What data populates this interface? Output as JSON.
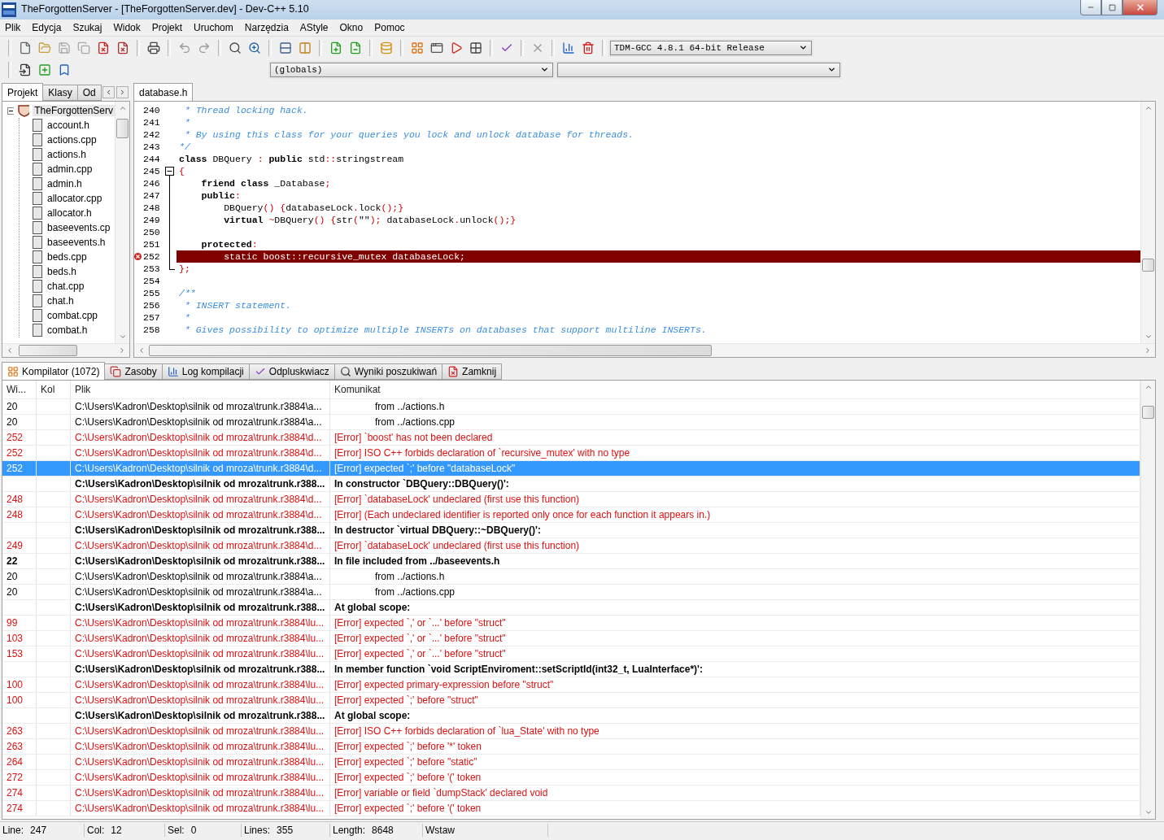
{
  "window": {
    "title": "TheForgottenServer - [TheForgottenServer.dev] - Dev-C++ 5.10"
  },
  "menu": [
    "Plik",
    "Edycja",
    "Szukaj",
    "Widok",
    "Projekt",
    "Uruchom",
    "Narzędzia",
    "AStyle",
    "Okno",
    "Pomoc"
  ],
  "toolbar": {
    "compiler": "TDM-GCC 4.8.1 64-bit Release",
    "scope": "(globals)"
  },
  "left_panel": {
    "tabs": [
      {
        "label": "Projekt",
        "selected": true
      },
      {
        "label": "Klasy",
        "selected": false
      },
      {
        "label": "Od",
        "selected": false
      }
    ],
    "tree": [
      {
        "label": "TheForgottenServ",
        "expanded": true,
        "children": [
          {
            "label": "account.h"
          },
          {
            "label": "actions.cpp"
          },
          {
            "label": "actions.h"
          },
          {
            "label": "admin.cpp"
          },
          {
            "label": "admin.h"
          },
          {
            "label": "allocator.cpp"
          },
          {
            "label": "allocator.h"
          },
          {
            "label": "baseevents.cp"
          },
          {
            "label": "baseevents.h"
          },
          {
            "label": "beds.cpp"
          },
          {
            "label": "beds.h"
          },
          {
            "label": "chat.cpp"
          },
          {
            "label": "chat.h"
          },
          {
            "label": "combat.cpp"
          },
          {
            "label": "combat.h"
          }
        ]
      }
    ]
  },
  "editor": {
    "tabs": [
      {
        "label": "database.h",
        "selected": true
      }
    ],
    "lines": [
      {
        "number": "240",
        "segments": [
          {
            "kind": "comment",
            "text": " * Thread locking hack."
          }
        ]
      },
      {
        "number": "241",
        "segments": [
          {
            "kind": "comment",
            "text": " *"
          }
        ]
      },
      {
        "number": "242",
        "segments": [
          {
            "kind": "comment",
            "text": " * By using this class for your queries you lock and unlock database for threads."
          }
        ]
      },
      {
        "number": "243",
        "segments": [
          {
            "kind": "comment",
            "text": "*/"
          }
        ]
      },
      {
        "number": "244",
        "segments": [
          {
            "kind": "keyword",
            "text": "class"
          },
          {
            "kind": "plain",
            "text": " DBQuery "
          },
          {
            "kind": "symbol",
            "text": ":"
          },
          {
            "kind": "keyword",
            "text": " public"
          },
          {
            "kind": "plain",
            "text": " std"
          },
          {
            "kind": "symbol",
            "text": "::"
          },
          {
            "kind": "plain",
            "text": "stringstream"
          }
        ]
      },
      {
        "number": "245",
        "fold_start": true,
        "segments": [
          {
            "kind": "symbol",
            "text": "{"
          }
        ]
      },
      {
        "number": "246",
        "in_fold": true,
        "segments": [
          {
            "kind": "keyword",
            "text": "    friend class"
          },
          {
            "kind": "plain",
            "text": " _Database"
          },
          {
            "kind": "symbol",
            "text": ";"
          }
        ]
      },
      {
        "number": "247",
        "in_fold": true,
        "segments": [
          {
            "kind": "keyword",
            "text": "    public"
          },
          {
            "kind": "symbol",
            "text": ":"
          }
        ]
      },
      {
        "number": "248",
        "in_fold": true,
        "segments": [
          {
            "kind": "plain",
            "text": "        DBQuery"
          },
          {
            "kind": "symbol",
            "text": "()"
          },
          {
            "kind": "symbol",
            "text": " {"
          },
          {
            "kind": "plain",
            "text": "databaseLock"
          },
          {
            "kind": "symbol",
            "text": "."
          },
          {
            "kind": "plain",
            "text": "lock"
          },
          {
            "kind": "symbol",
            "text": "();}"
          }
        ]
      },
      {
        "number": "249",
        "in_fold": true,
        "segments": [
          {
            "kind": "keyword",
            "text": "        virtual"
          },
          {
            "kind": "symbol",
            "text": " ~"
          },
          {
            "kind": "plain",
            "text": "DBQuery"
          },
          {
            "kind": "symbol",
            "text": "()"
          },
          {
            "kind": "symbol",
            "text": " {"
          },
          {
            "kind": "plain",
            "text": "str"
          },
          {
            "kind": "symbol",
            "text": "("
          },
          {
            "kind": "plain",
            "text": "\"\""
          },
          {
            "kind": "symbol",
            "text": ");"
          },
          {
            "kind": "plain",
            "text": " databaseLock"
          },
          {
            "kind": "symbol",
            "text": "."
          },
          {
            "kind": "plain",
            "text": "unlock"
          },
          {
            "kind": "symbol",
            "text": "();}"
          }
        ]
      },
      {
        "number": "250",
        "in_fold": true
      },
      {
        "number": "251",
        "in_fold": true,
        "segments": [
          {
            "kind": "keyword",
            "text": "    protected"
          },
          {
            "kind": "symbol",
            "text": ":"
          }
        ]
      },
      {
        "number": "252",
        "in_fold": true,
        "error": true,
        "segments": [
          {
            "kind": "plain",
            "text": "        static boost::recursive_mutex databaseLock;"
          }
        ]
      },
      {
        "number": "253",
        "fold_end": true,
        "segments": [
          {
            "kind": "symbol",
            "text": "};"
          }
        ]
      },
      {
        "number": "254"
      },
      {
        "number": "255",
        "segments": [
          {
            "kind": "comment",
            "text": "/**"
          }
        ]
      },
      {
        "number": "256",
        "segments": [
          {
            "kind": "comment",
            "text": " * INSERT statement."
          }
        ]
      },
      {
        "number": "257",
        "segments": [
          {
            "kind": "comment",
            "text": " *"
          }
        ]
      },
      {
        "number": "258",
        "segments": [
          {
            "kind": "comment",
            "text": " * Gives possibility to optimize multiple INSERTs on databases that support multiline INSERTs."
          }
        ]
      }
    ]
  },
  "bottom_tabs": [
    {
      "label": "Kompilator (1072)",
      "selected": true
    },
    {
      "label": "Zasoby",
      "selected": false
    },
    {
      "label": "Log kompilacji",
      "selected": false
    },
    {
      "label": "Odpluskwiacz",
      "selected": false
    },
    {
      "label": "Wyniki poszukiwań",
      "selected": false
    },
    {
      "label": "Zamknij",
      "selected": false
    }
  ],
  "messages": {
    "columns": [
      "Wi...",
      "Kol",
      "Plik",
      "Komunikat"
    ],
    "rows": [
      {
        "kind": "note",
        "line": "20",
        "file": "C:\\Users\\Kadron\\Desktop\\silnik od mroza\\trunk.r3884\\a...",
        "message": "from ../actions.h",
        "selected": false
      },
      {
        "kind": "note",
        "line": "20",
        "file": "C:\\Users\\Kadron\\Desktop\\silnik od mroza\\trunk.r3884\\a...",
        "message": "from ../actions.cpp",
        "selected": false
      },
      {
        "kind": "error",
        "line": "252",
        "file": "C:\\Users\\Kadron\\Desktop\\silnik od mroza\\trunk.r3884\\d...",
        "message": "[Error] `boost' has not been declared",
        "selected": false
      },
      {
        "kind": "error",
        "line": "252",
        "file": "C:\\Users\\Kadron\\Desktop\\silnik od mroza\\trunk.r3884\\d...",
        "message": "[Error] ISO C++ forbids declaration of `recursive_mutex' with no type",
        "selected": false
      },
      {
        "kind": "error",
        "line": "252",
        "file": "C:\\Users\\Kadron\\Desktop\\silnik od mroza\\trunk.r3884\\d...",
        "message": "[Error] expected `;' before \"databaseLock\"",
        "selected": true
      },
      {
        "kind": "context",
        "file": "C:\\Users\\Kadron\\Desktop\\silnik od mroza\\trunk.r388...",
        "message": "In constructor `DBQuery::DBQuery()':",
        "selected": false
      },
      {
        "kind": "error",
        "line": "248",
        "file": "C:\\Users\\Kadron\\Desktop\\silnik od mroza\\trunk.r3884\\d...",
        "message": "[Error] `databaseLock' undeclared (first use this function)",
        "selected": false
      },
      {
        "kind": "error",
        "line": "248",
        "file": "C:\\Users\\Kadron\\Desktop\\silnik od mroza\\trunk.r3884\\d...",
        "message": "[Error] (Each undeclared identifier is reported only once for each function it appears in.)",
        "selected": false
      },
      {
        "kind": "context",
        "file": "C:\\Users\\Kadron\\Desktop\\silnik od mroza\\trunk.r388...",
        "message": "In destructor `virtual DBQuery::~DBQuery()':",
        "selected": false
      },
      {
        "kind": "error",
        "line": "249",
        "file": "C:\\Users\\Kadron\\Desktop\\silnik od mroza\\trunk.r3884\\d...",
        "message": "[Error] `databaseLock' undeclared (first use this function)",
        "selected": false
      },
      {
        "kind": "context",
        "line": "22",
        "file": "C:\\Users\\Kadron\\Desktop\\silnik od mroza\\trunk.r388...",
        "message": "In file included from ../baseevents.h",
        "selected": false
      },
      {
        "kind": "note",
        "line": "20",
        "file": "C:\\Users\\Kadron\\Desktop\\silnik od mroza\\trunk.r3884\\a...",
        "message": "from ../actions.h",
        "selected": false
      },
      {
        "kind": "note",
        "line": "20",
        "file": "C:\\Users\\Kadron\\Desktop\\silnik od mroza\\trunk.r3884\\a...",
        "message": "from ../actions.cpp",
        "selected": false
      },
      {
        "kind": "context",
        "file": "C:\\Users\\Kadron\\Desktop\\silnik od mroza\\trunk.r388...",
        "message": "At global scope:",
        "selected": false
      },
      {
        "kind": "error",
        "line": "99",
        "file": "C:\\Users\\Kadron\\Desktop\\silnik od mroza\\trunk.r3884\\lu...",
        "message": "[Error] expected `,' or `...' before \"struct\"",
        "selected": false
      },
      {
        "kind": "error",
        "line": "103",
        "file": "C:\\Users\\Kadron\\Desktop\\silnik od mroza\\trunk.r3884\\lu...",
        "message": "[Error] expected `,' or `...' before \"struct\"",
        "selected": false
      },
      {
        "kind": "error",
        "line": "153",
        "file": "C:\\Users\\Kadron\\Desktop\\silnik od mroza\\trunk.r3884\\lu...",
        "message": "[Error] expected `,' or `...' before \"struct\"",
        "selected": false
      },
      {
        "kind": "context",
        "file": "C:\\Users\\Kadron\\Desktop\\silnik od mroza\\trunk.r388...",
        "message": "In member function `void ScriptEnviroment::setScriptId(int32_t, LuaInterface*)':",
        "selected": false
      },
      {
        "kind": "error",
        "line": "100",
        "file": "C:\\Users\\Kadron\\Desktop\\silnik od mroza\\trunk.r3884\\lu...",
        "message": "[Error] expected primary-expression before \"struct\"",
        "selected": false
      },
      {
        "kind": "error",
        "line": "100",
        "file": "C:\\Users\\Kadron\\Desktop\\silnik od mroza\\trunk.r3884\\lu...",
        "message": "[Error] expected `;' before \"struct\"",
        "selected": false
      },
      {
        "kind": "context",
        "file": "C:\\Users\\Kadron\\Desktop\\silnik od mroza\\trunk.r388...",
        "message": "At global scope:",
        "selected": false
      },
      {
        "kind": "error",
        "line": "263",
        "file": "C:\\Users\\Kadron\\Desktop\\silnik od mroza\\trunk.r3884\\lu...",
        "message": "[Error] ISO C++ forbids declaration of `lua_State' with no type",
        "selected": false
      },
      {
        "kind": "error",
        "line": "263",
        "file": "C:\\Users\\Kadron\\Desktop\\silnik od mroza\\trunk.r3884\\lu...",
        "message": "[Error] expected `;' before '*' token",
        "selected": false
      },
      {
        "kind": "error",
        "line": "264",
        "file": "C:\\Users\\Kadron\\Desktop\\silnik od mroza\\trunk.r3884\\lu...",
        "message": "[Error] expected `;' before \"static\"",
        "selected": false
      },
      {
        "kind": "error",
        "line": "272",
        "file": "C:\\Users\\Kadron\\Desktop\\silnik od mroza\\trunk.r3884\\lu...",
        "message": "[Error] expected `;' before '(' token",
        "selected": false
      },
      {
        "kind": "error",
        "line": "274",
        "file": "C:\\Users\\Kadron\\Desktop\\silnik od mroza\\trunk.r3884\\lu...",
        "message": "[Error] variable or field `dumpStack' declared void",
        "selected": false
      },
      {
        "kind": "error",
        "line": "274",
        "file": "C:\\Users\\Kadron\\Desktop\\silnik od mroza\\trunk.r3884\\lu...",
        "message": "[Error] expected `;' before '(' token",
        "selected": false
      }
    ]
  },
  "status_bar": [
    {
      "label": "Line:",
      "value": "247"
    },
    {
      "label": "Col:",
      "value": "12"
    },
    {
      "label": "Sel:",
      "value": "0"
    },
    {
      "label": "Lines:",
      "value": "355"
    },
    {
      "label": "Length:",
      "value": "8648"
    },
    {
      "label": "Wstaw"
    }
  ]
}
